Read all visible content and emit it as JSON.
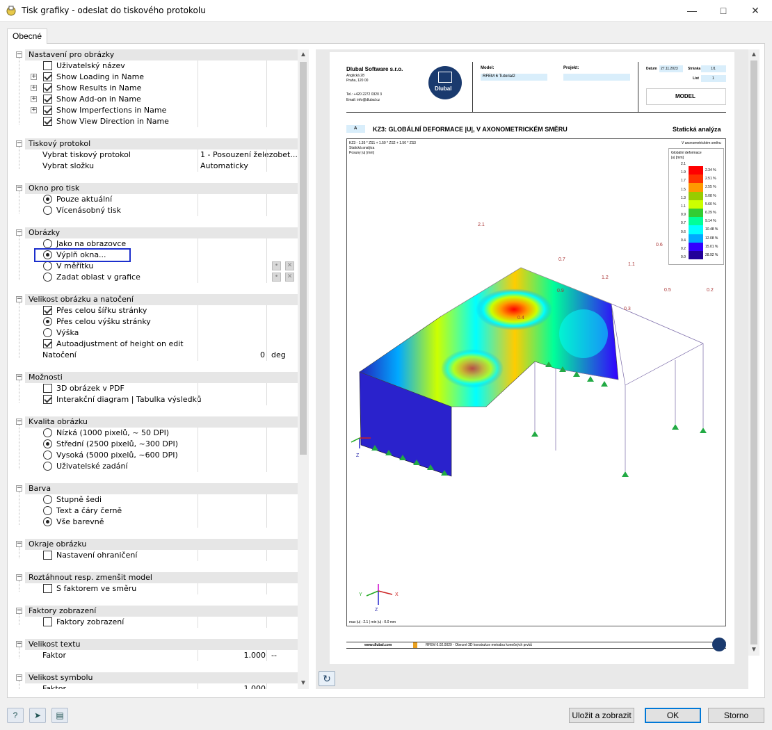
{
  "window": {
    "title": "Tisk grafiky - odeslat do tiskového protokolu"
  },
  "tab": {
    "label": "Obecné"
  },
  "groups": {
    "g1": {
      "title": "Nastavení pro obrázky",
      "items": [
        "Uživatelský název",
        "Show Loading in Name",
        "Show Results in Name",
        "Show Add-on in Name",
        "Show Imperfections in Name",
        "Show View Direction in Name"
      ]
    },
    "g2": {
      "title": "Tiskový protokol",
      "rows": [
        {
          "label": "Vybrat tiskový protokol",
          "value": "1 - Posouzení železobet..."
        },
        {
          "label": "Vybrat složku",
          "value": "Automaticky"
        }
      ]
    },
    "g3": {
      "title": "Okno pro tisk",
      "items": [
        "Pouze aktuální",
        "Vícenásobný tisk"
      ]
    },
    "g4": {
      "title": "Obrázky",
      "items": [
        "Jako na obrazovce",
        "Výplň okna...",
        "V měřítku",
        "Zadat oblast v grafice"
      ]
    },
    "g5": {
      "title": "Velikost obrázku a natočení",
      "items": [
        "Přes celou šířku stránky",
        "Přes celou výšku stránky",
        "Výška",
        "Autoadjustment of height on edit"
      ],
      "rot_label": "Natočení",
      "rot_value": "0",
      "rot_unit": "deg"
    },
    "g6": {
      "title": "Možnosti",
      "items": [
        "3D obrázek v PDF",
        "Interakční diagram | Tabulka výsledků"
      ]
    },
    "g7": {
      "title": "Kvalita obrázku",
      "items": [
        "Nízká (1000 pixelů, ~ 50 DPI)",
        "Střední (2500 pixelů, ~300 DPI)",
        "Vysoká (5000 pixelů, ~600 DPI)",
        "Uživatelské zadání"
      ]
    },
    "g8": {
      "title": "Barva",
      "items": [
        "Stupně šedi",
        "Text a čáry černě",
        "Vše barevně"
      ]
    },
    "g9": {
      "title": "Okraje obrázku",
      "items": [
        "Nastavení ohraničení"
      ]
    },
    "g10": {
      "title": "Roztáhnout resp. zmenšit model",
      "items": [
        "S faktorem ve směru"
      ]
    },
    "g11": {
      "title": "Faktory zobrazení",
      "items": [
        "Faktory zobrazení"
      ]
    },
    "g12": {
      "title": "Velikost textu",
      "label": "Faktor",
      "value": "1.000",
      "unit": "--"
    },
    "g13": {
      "title": "Velikost symbolu",
      "label": "Faktor",
      "value": "1.000"
    }
  },
  "preview": {
    "company": "Dlubal Software s.r.o.",
    "addr1": "Anglická 28",
    "addr2": "Praha, 120 00",
    "tel": "Tel.: +420 2272 0320 3",
    "email": "Email: info@dlubal.cz",
    "logo_text": "Dlubal",
    "model_label": "Model:",
    "model_value": "RFEM 6 Tutorial2",
    "project_label": "Projekt:",
    "date_label": "Datum",
    "date_value": "27.11.2023",
    "page_label": "Stránka",
    "page_value": "1/1",
    "sheet_label": "List",
    "sheet_value": "1",
    "model_box": "MODEL",
    "section_letter": "A",
    "heading": "KZ3: GLOBÁLNÍ DEFORMACE |U|, V AXONOMETRICKÉM SMĚRU",
    "heading_right": "Statická analýza",
    "combo": "KZ3 - 1.35 * ZS1 + 1.50 * ZS2 + 1.50 * ZS3",
    "combo2": "Statická analýza",
    "combo3": "Posuny |u| [mm]",
    "view_dir": "V axonometrickém směru",
    "legend_title": "Globální deformace",
    "legend_sub": "|u| [mm]",
    "legend_values": [
      "2.1",
      "1.9",
      "1.7",
      "1.5",
      "1.3",
      "1.1",
      "0.9",
      "0.7",
      "0.6",
      "0.4",
      "0.2",
      "0.0"
    ],
    "legend_percents": [
      "2.34 %",
      "2.51 %",
      "2.55 %",
      "5.08 %",
      "5.60 %",
      "6.29 %",
      "9.14 %",
      "10.48 %",
      "12.08 %",
      "15.01 %",
      "28.92 %"
    ],
    "legend_colors": [
      "#ff0000",
      "#ff3300",
      "#ff9900",
      "#99cc00",
      "#ccff00",
      "#33cc33",
      "#00ff99",
      "#00ffff",
      "#00aaff",
      "#3300ff",
      "#220099"
    ],
    "maxmin": "max |u| : 2.1 | min |u| : 0.0 mm",
    "footer_web": "www.dlubal.com",
    "footer_prog": "RFEM 6.02.0029 - Obecné 3D konstrukce metodou konečných prvků",
    "labels3d": [
      "2.1",
      "0.7",
      "0.9",
      "0.6",
      "1.1",
      "1.2",
      "0.5",
      "0.2",
      "0.3",
      "0.4"
    ],
    "axis_x": "X",
    "axis_y": "Y",
    "axis_z": "Z"
  },
  "buttons": {
    "save": "Uložit a zobrazit",
    "ok": "OK",
    "cancel": "Storno"
  },
  "icons": [
    "help-icon",
    "arrow-icon",
    "save-icon",
    "refresh-icon"
  ]
}
